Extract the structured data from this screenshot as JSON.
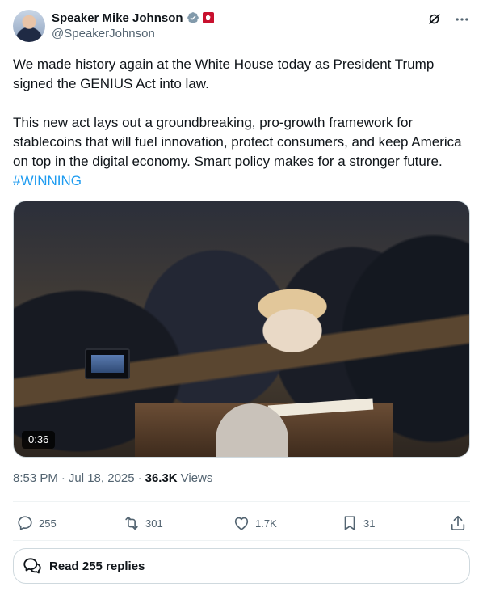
{
  "author": {
    "name": "Speaker Mike Johnson",
    "handle": "@SpeakerJohnson",
    "avatar_icon": "profile-photo",
    "verified_icon": "verified-badge-icon",
    "affiliation_icon": "house-seal-icon",
    "accent_color": "#1d9bf0"
  },
  "header_actions": {
    "grok_icon": "grok-icon",
    "more_icon": "more-dots-icon"
  },
  "tweet": {
    "paragraph1": "We made history again at the White House today as President Trump signed the GENIUS Act into law.",
    "paragraph2": "This new act lays out a groundbreaking, pro-growth framework for stablecoins that will fuel innovation, protect consumers, and keep America on top in the digital economy. Smart policy makes for a stronger future.",
    "hashtag": "#WINNING"
  },
  "media": {
    "type": "video",
    "duration": "0:36"
  },
  "meta": {
    "time": "8:53 PM",
    "separator1": "·",
    "date": "Jul 18, 2025",
    "separator2": "·",
    "views_count": "36.3K",
    "views_label": "Views"
  },
  "actions": {
    "replies": "255",
    "reposts": "301",
    "likes": "1.7K",
    "bookmarks": "31",
    "reply_icon": "reply-icon",
    "repost_icon": "repost-icon",
    "like_icon": "heart-icon",
    "bookmark_icon": "bookmark-icon",
    "share_icon": "share-icon"
  },
  "read_replies": {
    "label": "Read 255 replies",
    "icon": "speech-bubbles-icon"
  }
}
